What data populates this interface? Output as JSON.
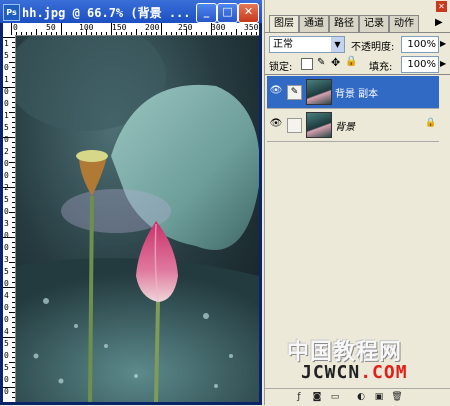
{
  "document": {
    "title": "hh.jpg @ 66.7% (背景 ...",
    "app_icon": "photoshop-icon",
    "ruler_top_labels": [
      "0",
      "50",
      "100",
      "150",
      "200",
      "250",
      "300",
      "350"
    ],
    "ruler_left_labels": [
      "1",
      "5",
      "0",
      "1",
      "0",
      "0",
      "1",
      "5",
      "0",
      "2",
      "0",
      "0",
      "2",
      "5",
      "0",
      "3",
      "0",
      "0",
      "3",
      "5",
      "0",
      "4",
      "0",
      "0",
      "4",
      "5",
      "0",
      "5",
      "0",
      "0"
    ]
  },
  "palette": {
    "tabs": [
      "图层",
      "通道",
      "路径",
      "记录",
      "动作"
    ],
    "blend_mode": "正常",
    "opacity_label": "不透明度:",
    "opacity_value": "100%",
    "lock_label": "锁定:",
    "fill_label": "填充:",
    "fill_value": "100%",
    "layers": [
      {
        "name": "背景 副本",
        "selected": true,
        "visible": true
      },
      {
        "name": "背景",
        "selected": false,
        "visible": true,
        "locked": true
      }
    ]
  },
  "watermark": {
    "line1": "中国教程网",
    "line2": "JCWCN.COM"
  },
  "colors": {
    "titlebar": "#1c4fc2",
    "selection": "#316ac5",
    "palette_bg": "#ece9d8"
  }
}
